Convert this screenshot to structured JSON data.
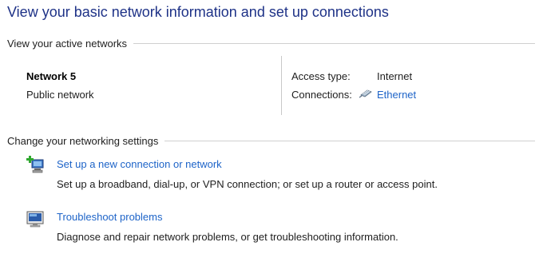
{
  "page": {
    "title": "View your basic network information and set up connections"
  },
  "active_networks": {
    "header": "View your active networks",
    "network_name": "Network 5",
    "network_type": "Public network",
    "access_type_label": "Access type:",
    "access_type_value": "Internet",
    "connections_label": "Connections:",
    "connection_link": "Ethernet",
    "connection_icon": "ethernet-icon"
  },
  "settings": {
    "header": "Change your networking settings",
    "tasks": [
      {
        "icon": "new-connection-icon",
        "link": "Set up a new connection or network",
        "description": "Set up a broadband, dial-up, or VPN connection; or set up a router or access point."
      },
      {
        "icon": "troubleshoot-icon",
        "link": "Troubleshoot problems",
        "description": "Diagnose and repair network problems, or get troubleshooting information."
      }
    ]
  },
  "colors": {
    "title": "#1e3287",
    "link": "#1e64c8",
    "text": "#1e1e1e"
  }
}
